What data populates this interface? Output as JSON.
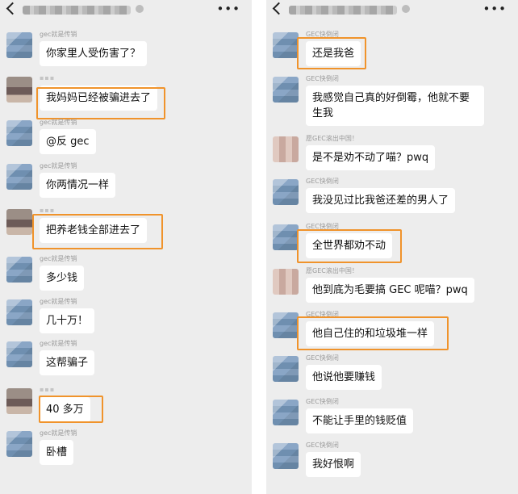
{
  "left": {
    "messages": [
      {
        "sender": "gec就是传销",
        "text": "你家里人受伤害了？"
      },
      {
        "sender": "",
        "text": "我妈妈已经被骗进去了"
      },
      {
        "sender": "gec就是传销",
        "text": "@反 gec"
      },
      {
        "sender": "gec就是传销",
        "text": "你两情况一样"
      },
      {
        "sender": "",
        "text": "把养老钱全部进去了"
      },
      {
        "sender": "gec就是传销",
        "text": "多少钱"
      },
      {
        "sender": "gec就是传销",
        "text": "几十万！"
      },
      {
        "sender": "gec就是传销",
        "text": "这帮骗子"
      },
      {
        "sender": "",
        "text": "40 多万"
      },
      {
        "sender": "gec就是传销",
        "text": "卧槽"
      }
    ]
  },
  "right": {
    "messages": [
      {
        "sender": "GEC快倒闭",
        "text": "还是我爸"
      },
      {
        "sender": "GEC快倒闭",
        "text": "我感觉自己真的好倒霉，他就不要生我"
      },
      {
        "sender": "愿GEC滚出中国！",
        "text": "是不是劝不动了喵？pwq"
      },
      {
        "sender": "GEC快倒闭",
        "text": "我没见过比我爸还差的男人了"
      },
      {
        "sender": "GEC快倒闭",
        "text": "全世界都劝不动"
      },
      {
        "sender": "愿GEC滚出中国！",
        "text": "他到底为毛要搞 GEC 呢喵？pwq"
      },
      {
        "sender": "GEC快倒闭",
        "text": "他自己住的和垃圾堆一样"
      },
      {
        "sender": "GEC快倒闭",
        "text": "他说他要赚钱"
      },
      {
        "sender": "GEC快倒闭",
        "text": "不能让手里的钱贬值"
      },
      {
        "sender": "GEC快倒闭",
        "text": "我好恨啊"
      }
    ]
  },
  "icons": {
    "back": "chevron-left-icon",
    "more": "more-dots-icon"
  },
  "colors": {
    "highlight": "#f0932b",
    "background": "#ededed",
    "bubble": "#ffffff"
  }
}
